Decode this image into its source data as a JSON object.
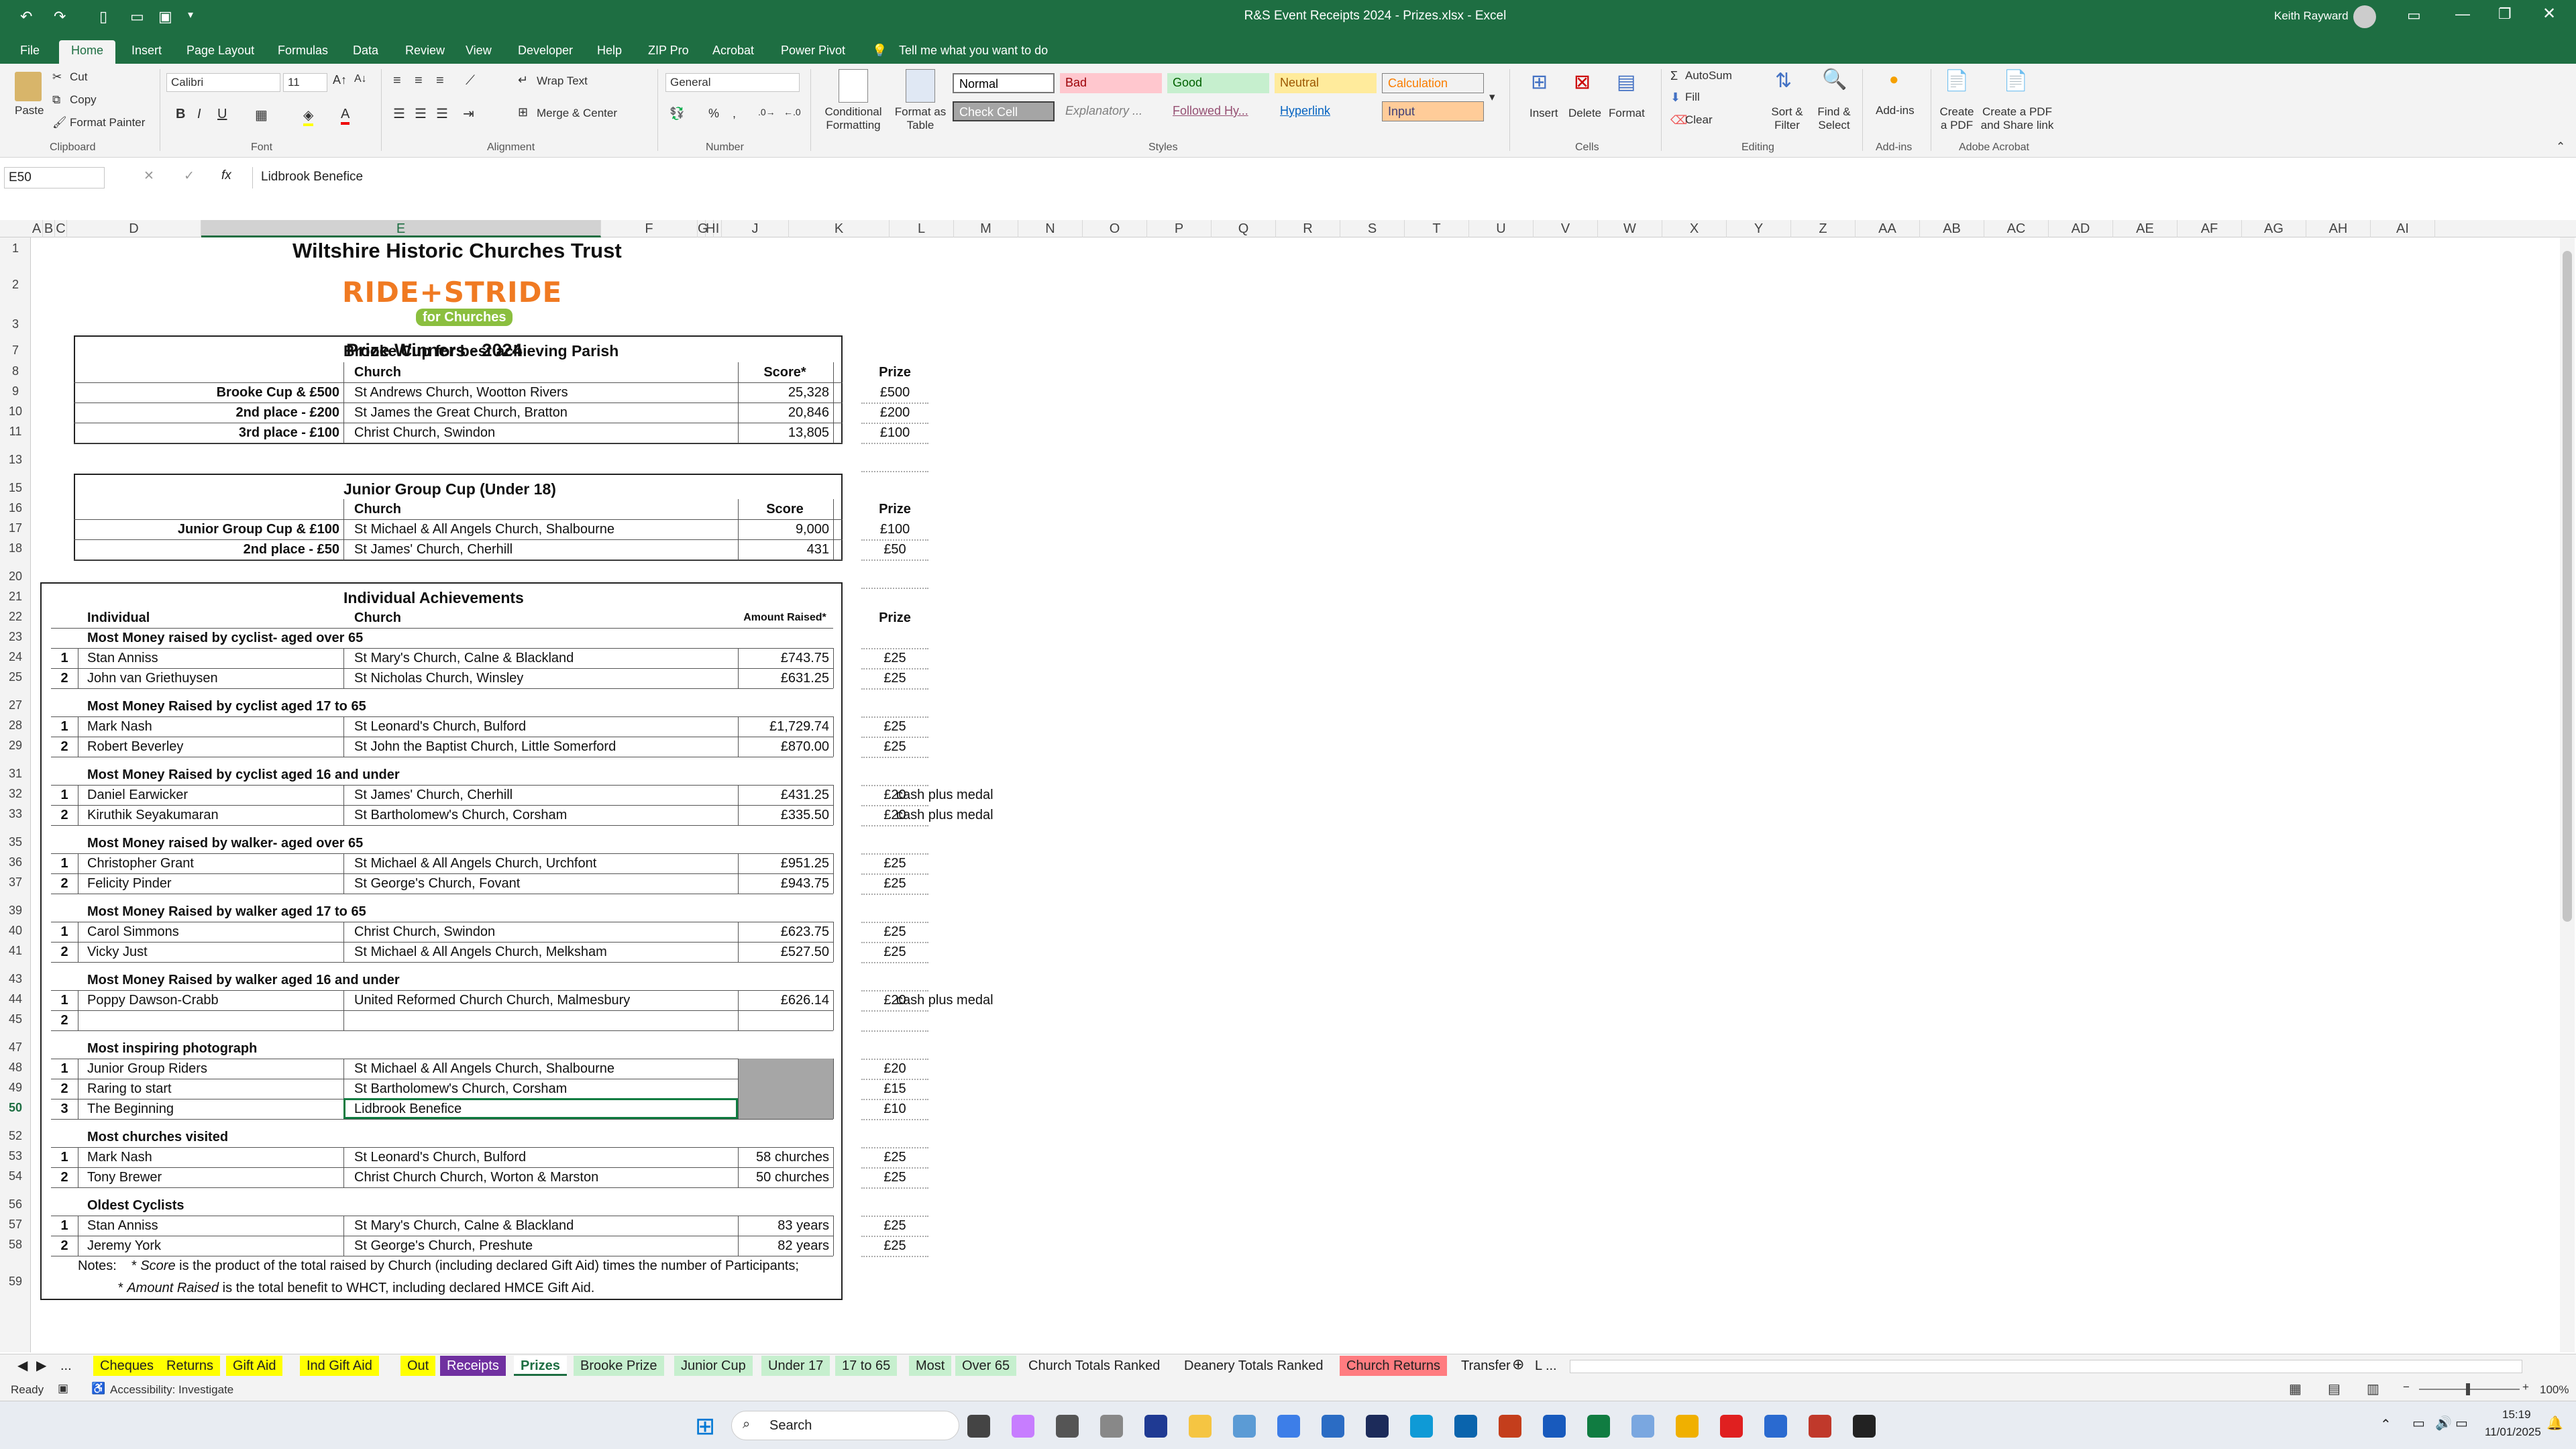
{
  "window": {
    "title": "R&S Event Receipts 2024 - Prizes.xlsx  -  Excel",
    "user": "Keith Rayward"
  },
  "menu": [
    "File",
    "Home",
    "Insert",
    "Page Layout",
    "Formulas",
    "Data",
    "Review",
    "View",
    "Developer",
    "Help",
    "ZIP Pro",
    "Acrobat",
    "Power Pivot"
  ],
  "tell_me": "Tell me what you want to do",
  "ribbon": {
    "clipboard": {
      "paste": "Paste",
      "cut": "Cut",
      "copy": "Copy",
      "format_painter": "Format Painter",
      "group": "Clipboard"
    },
    "font": {
      "name": "Calibri",
      "size": "11",
      "group": "Font"
    },
    "alignment": {
      "wrap": "Wrap Text",
      "merge": "Merge & Center",
      "group": "Alignment"
    },
    "number": {
      "format": "General",
      "group": "Number"
    },
    "styles": {
      "conditional": "Conditional Formatting",
      "format_table": "Format as Table",
      "group": "Styles",
      "normal": "Normal",
      "bad": "Bad",
      "good": "Good",
      "neutral": "Neutral",
      "calculation": "Calculation",
      "check_cell": "Check Cell",
      "explanatory": "Explanatory ...",
      "followed": "Followed Hy...",
      "hyperlink": "Hyperlink",
      "input": "Input"
    },
    "cells": {
      "insert": "Insert",
      "delete": "Delete",
      "format": "Format",
      "group": "Cells"
    },
    "editing": {
      "autosum": "AutoSum",
      "fill": "Fill",
      "clear": "Clear",
      "sort": "Sort & Filter",
      "find": "Find & Select",
      "group": "Editing"
    },
    "addins": {
      "label": "Add-ins",
      "group": "Add-ins"
    },
    "acrobat": {
      "create_pdf": "Create a PDF",
      "share": "Create a PDF and Share link",
      "group": "Adobe Acrobat"
    }
  },
  "formula_bar": {
    "name_box": "E50",
    "content": "Lidbrook Benefice",
    "fx": "fx"
  },
  "columns": [
    "A",
    "B",
    "C",
    "D",
    "E",
    "F",
    "G",
    "H",
    "I",
    "J",
    "K",
    "L",
    "M",
    "N",
    "O",
    "P",
    "Q",
    "R",
    "S",
    "T",
    "U",
    "V",
    "W",
    "X",
    "Y",
    "Z",
    "AA",
    "AB",
    "AC",
    "AD",
    "AE",
    "AF",
    "AG",
    "AH",
    "AI"
  ],
  "sheet": {
    "org": "Wiltshire Historic Churches Trust",
    "logo_text": "RIDE+STRIDE",
    "logo_sub": "for Churches",
    "heading": "Prize Winners - 2024",
    "brooke": {
      "title": "Brooke Cup for best achieving Parish",
      "col_church": "Church",
      "col_score": "Score*",
      "col_prize": "Prize",
      "rows": [
        {
          "label": "Brooke Cup & £500",
          "church": "St Andrews Church, Wootton Rivers",
          "score": "25,328",
          "prize": "£500"
        },
        {
          "label": "2nd place - £200",
          "church": "St James the Great Church, Bratton",
          "score": "20,846",
          "prize": "£200"
        },
        {
          "label": "3rd place - £100",
          "church": "Christ Church, Swindon",
          "score": "13,805",
          "prize": "£100"
        }
      ]
    },
    "junior": {
      "title": "Junior Group Cup (Under 18)",
      "col_church": "Church",
      "col_score": "Score",
      "col_prize": "Prize",
      "rows": [
        {
          "label": "Junior Group Cup & £100",
          "church": "St Michael & All Angels Church, Shalbourne",
          "score": "9,000",
          "prize": "£100"
        },
        {
          "label": "2nd place - £50",
          "church": "St James' Church, Cherhill",
          "score": "431",
          "prize": "£50"
        }
      ]
    },
    "individual": {
      "title": "Individual Achievements",
      "col_individual": "Individual",
      "col_church": "Church",
      "col_amount": "Amount Raised*",
      "col_prize": "Prize",
      "sections": [
        {
          "title": "Most Money raised by cyclist- aged over 65",
          "rows": [
            {
              "n": "1",
              "name": "Stan Anniss",
              "church": "St Mary's Church, Calne & Blackland",
              "amount": "£743.75",
              "prize": "£25"
            },
            {
              "n": "2",
              "name": "John  van Griethuysen",
              "church": "St Nicholas Church, Winsley",
              "amount": "£631.25",
              "prize": "£25"
            }
          ]
        },
        {
          "title": "Most Money Raised by cyclist aged 17 to 65",
          "rows": [
            {
              "n": "1",
              "name": "Mark Nash",
              "church": "St Leonard's Church, Bulford",
              "amount": "£1,729.74",
              "prize": "£25"
            },
            {
              "n": "2",
              "name": "Robert  Beverley",
              "church": "St John the Baptist Church, Little Somerford",
              "amount": "£870.00",
              "prize": "£25"
            }
          ]
        },
        {
          "title": "Most Money Raised by cyclist aged 16 and under",
          "rows": [
            {
              "n": "1",
              "name": "Daniel Earwicker",
              "church": "St James' Church, Cherhill",
              "amount": "£431.25",
              "prize": "£20",
              "note": "cash plus medal"
            },
            {
              "n": "2",
              "name": "Kiruthik Seyakumaran",
              "church": "St Bartholomew's Church, Corsham",
              "amount": "£335.50",
              "prize": "£20",
              "note": "cash plus medal"
            }
          ]
        },
        {
          "title": "Most Money raised by walker- aged over 65",
          "rows": [
            {
              "n": "1",
              "name": "Christopher Grant",
              "church": "St Michael & All Angels Church, Urchfont",
              "amount": "£951.25",
              "prize": "£25"
            },
            {
              "n": "2",
              "name": "Felicity Pinder",
              "church": "St George's Church, Fovant",
              "amount": "£943.75",
              "prize": "£25"
            }
          ]
        },
        {
          "title": "Most Money Raised by walker aged 17 to 65",
          "rows": [
            {
              "n": "1",
              "name": "Carol Simmons",
              "church": "Christ Church, Swindon",
              "amount": "£623.75",
              "prize": "£25"
            },
            {
              "n": "2",
              "name": "Vicky Just",
              "church": "St Michael & All Angels Church, Melksham",
              "amount": "£527.50",
              "prize": "£25"
            }
          ]
        },
        {
          "title": "Most Money Raised by walker aged 16 and under",
          "rows": [
            {
              "n": "1",
              "name": "Poppy Dawson-Crabb",
              "church": "United Reformed Church Church, Malmesbury",
              "amount": "£626.14",
              "prize": "£20",
              "note": "cash plus medal"
            },
            {
              "n": "2",
              "name": "",
              "church": "",
              "amount": "",
              "prize": ""
            }
          ]
        },
        {
          "title": "Most inspiring photograph",
          "rows": [
            {
              "n": "1",
              "name": "Junior Group Riders",
              "church": "St Michael & All Angels Church, Shalbourne",
              "amount": "",
              "prize": "£20"
            },
            {
              "n": "2",
              "name": "Raring to start",
              "church": "St Bartholomew's Church, Corsham",
              "amount": "",
              "prize": "£15"
            },
            {
              "n": "3",
              "name": "The Beginning",
              "church": "Lidbrook Benefice",
              "amount": "",
              "prize": "£10"
            }
          ]
        },
        {
          "title": "Most churches visited",
          "rows": [
            {
              "n": "1",
              "name": "Mark Nash",
              "church": "St Leonard's Church, Bulford",
              "amount": "58 churches",
              "prize": "£25"
            },
            {
              "n": "2",
              "name": "Tony Brewer",
              "church": "Christ Church Church, Worton & Marston",
              "amount": "50 churches",
              "prize": "£25"
            }
          ]
        },
        {
          "title": "Oldest Cyclists",
          "rows": [
            {
              "n": "1",
              "name": "Stan Anniss",
              "church": "St Mary's Church, Calne & Blackland",
              "amount": "83 years",
              "prize": "£25"
            },
            {
              "n": "2",
              "name": "Jeremy York",
              "church": "St George's Church, Preshute",
              "amount": "82 years",
              "prize": "£25"
            }
          ]
        }
      ]
    },
    "notes": {
      "label": "Notes:",
      "line1_pre": "* ",
      "line1_em": "Score",
      "line1_post": "  is the product of the total raised by Church (including declared Gift Aid) times the number of Participants;",
      "line2_pre": "* ",
      "line2_em": "Amount Raised",
      "line2_post": "  is the total benefit to WHCT, including declared HMCE Gift Aid."
    }
  },
  "tabs": [
    "...",
    "Cheques",
    "Returns",
    "Gift Aid",
    "Ind Gift Aid",
    "Out",
    "Receipts",
    "Prizes",
    "Brooke Prize",
    "Junior Cup",
    "Under 17",
    "17 to 65",
    "Most",
    "Over 65",
    "Church Totals Ranked",
    "Deanery Totals Ranked",
    "Church Returns",
    "Transfer",
    "L ..."
  ],
  "status": {
    "ready": "Ready",
    "accessibility": "Accessibility: Investigate",
    "zoom": "100%"
  },
  "taskbar": {
    "search": "Search",
    "time": "15:19",
    "date": "11/01/2025"
  },
  "colors": {
    "excel_green": "#1e6e42",
    "tab_yellow": "#ffff00",
    "tab_purple": "#7030a0",
    "tab_green": "#c6efce",
    "tab_red": "#ff7c80"
  }
}
